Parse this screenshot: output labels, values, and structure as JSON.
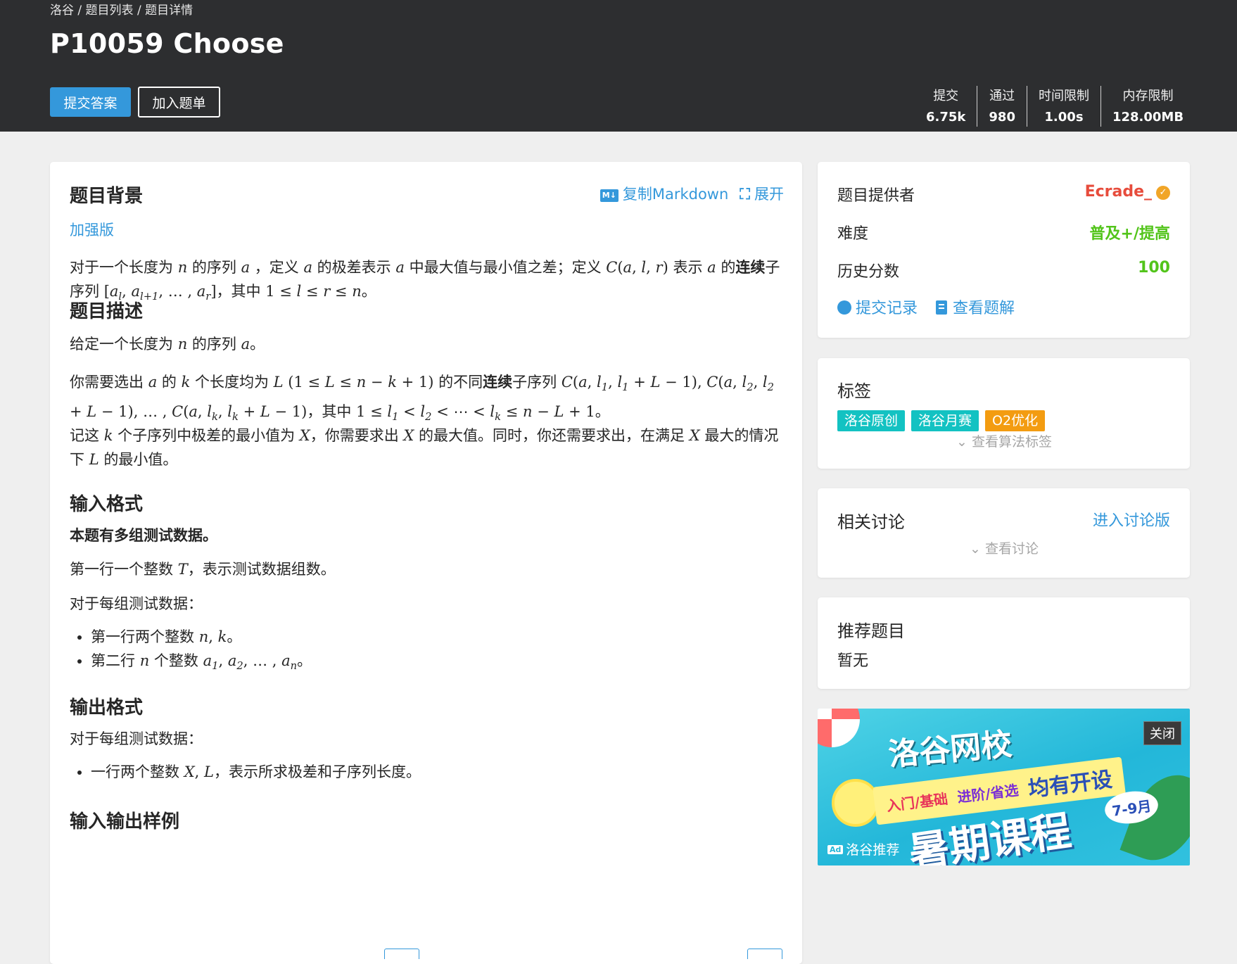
{
  "breadcrumb": {
    "home": "洛谷",
    "sep1": " / ",
    "problem_list": "题目列表",
    "sep2": " / ",
    "current": "题目详情"
  },
  "title": "P10059 Choose",
  "actions": {
    "submit": "提交答案",
    "add_to_list": "加入题单"
  },
  "stats": [
    {
      "label": "提交",
      "value": "6.75k"
    },
    {
      "label": "通过",
      "value": "980"
    },
    {
      "label": "时间限制",
      "value": "1.00s"
    },
    {
      "label": "内存限制",
      "value": "128.00MB"
    }
  ],
  "content": {
    "copy_markdown": "复制Markdown",
    "expand": "展开",
    "md_icon": "M↓",
    "background": {
      "title": "题目背景",
      "link": "加强版"
    },
    "description_title": "题目描述",
    "input_title": "输入格式",
    "input_bold": "本题有多组测试数据。",
    "input_each": "对于每组测试数据：",
    "output_title": "输出格式",
    "output_each": "对于每组测试数据：",
    "samples_title": "输入输出样例"
  },
  "sidebar": {
    "provider_label": "题目提供者",
    "provider": "Ecrade_",
    "difficulty_label": "难度",
    "difficulty": "普及+/提高",
    "score_label": "历史分数",
    "score": "100",
    "records": "提交记录",
    "solutions": "查看题解",
    "tags_title": "标签",
    "tags": [
      {
        "label": "洛谷原创",
        "color": "#13c2c2"
      },
      {
        "label": "洛谷月赛",
        "color": "#13c2c2"
      },
      {
        "label": "O2优化",
        "color": "#f39c11"
      }
    ],
    "view_algo_tags": "查看算法标签",
    "discussion_title": "相关讨论",
    "enter_discussion": "进入讨论版",
    "view_discussion": "查看讨论",
    "recommended_title": "推荐题目",
    "recommended_empty": "暂无"
  },
  "ad": {
    "brand": "洛谷网校",
    "levels_a": "入门/基础",
    "levels_b": "进阶/省选",
    "offer": "均有开设",
    "headline": "暑期课程",
    "months": "7-9月",
    "close": "关闭",
    "ad_box": "Ad",
    "label": "洛谷推荐"
  }
}
